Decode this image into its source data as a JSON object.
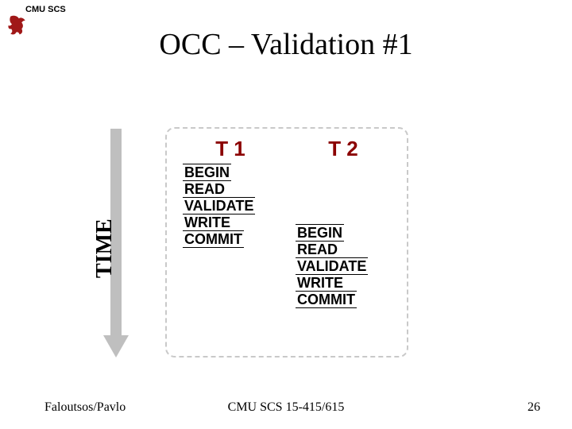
{
  "header": {
    "org": "CMU SCS",
    "title": "OCC – Validation #1"
  },
  "timeline": {
    "label": "TIME"
  },
  "schedule": {
    "t1": {
      "name": "T 1",
      "ops": [
        "BEGIN",
        "READ",
        "VALIDATE",
        "WRITE",
        "COMMIT"
      ]
    },
    "t2": {
      "name": "T 2",
      "ops": [
        "BEGIN",
        "READ",
        "VALIDATE",
        "WRITE",
        "COMMIT"
      ]
    }
  },
  "footer": {
    "left": "Faloutsos/Pavlo",
    "center": "CMU SCS 15-415/615",
    "right": "26"
  },
  "icons": {
    "griffin_color": "#a01818"
  }
}
